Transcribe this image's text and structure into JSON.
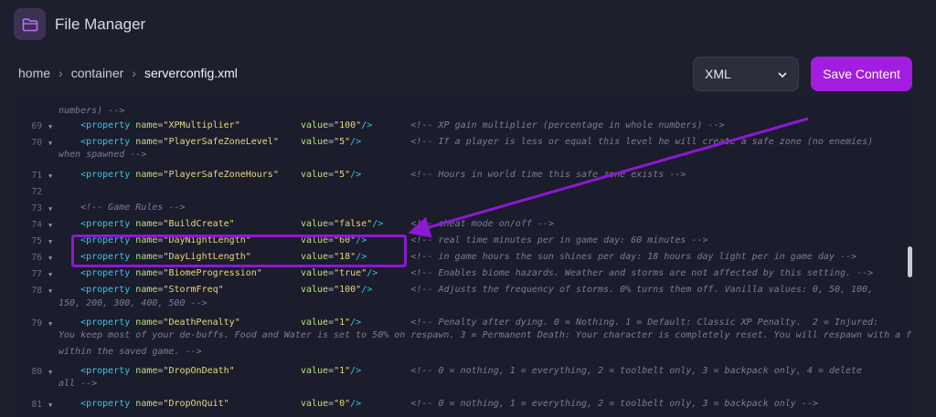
{
  "app": {
    "title": "File Manager",
    "icon": "folder-icon"
  },
  "breadcrumb": [
    "home",
    "container",
    "serverconfig.xml"
  ],
  "format_select": {
    "value": "XML"
  },
  "save_button": "Save Content",
  "editor": {
    "top_wrap": "numbers) -->",
    "lines": [
      {
        "num": "69",
        "fold": true,
        "name": "XPMultiplier",
        "value": "100",
        "comment": "<!-- XP gain multiplier (percentage in whole numbers) -->",
        "wrap": []
      },
      {
        "num": "70",
        "fold": true,
        "name": "PlayerSafeZoneLevel",
        "value": "5",
        "comment": "<!-- If a player is less or equal this level he will create a safe zone (no enemies)",
        "wrap": [
          "when spawned -->"
        ]
      },
      {
        "num": "71",
        "fold": true,
        "name": "PlayerSafeZoneHours",
        "value": "5",
        "comment": "<!-- Hours in world time this safe zone exists -->",
        "wrap": []
      },
      {
        "num": "72",
        "fold": false,
        "raw": "",
        "wrap": []
      },
      {
        "num": "73",
        "fold": true,
        "raw_comment": "<!-- Game Rules -->",
        "wrap": []
      },
      {
        "num": "74",
        "fold": true,
        "name": "BuildCreate",
        "value": "false",
        "comment": "<!-- cheat mode on/off -->",
        "wrap": []
      },
      {
        "num": "75",
        "fold": true,
        "name": "DayNightLength",
        "value": "60",
        "comment": "<!-- real time minutes per in game day: 60 minutes -->",
        "wrap": []
      },
      {
        "num": "76",
        "fold": true,
        "name": "DayLightLength",
        "value": "18",
        "comment": "<!-- in game hours the sun shines per day: 18 hours day light per in game day -->",
        "wrap": []
      },
      {
        "num": "77",
        "fold": true,
        "name": "BiomeProgression",
        "value": "true",
        "comment": "<!-- Enables biome hazards. Weather and storms are not affected by this setting. -->",
        "wrap": []
      },
      {
        "num": "78",
        "fold": true,
        "name": "StormFreq",
        "value": "100",
        "comment": "<!-- Adjusts the frequency of storms. 0% turns them off. Vanilla values: 0, 50, 100,",
        "wrap": [
          "150, 200, 300, 400, 500 -->"
        ]
      },
      {
        "num": "79",
        "fold": true,
        "name": "DeathPenalty",
        "value": "1",
        "comment": "<!-- Penalty after dying. 0 = Nothing. 1 = Default: Classic XP Penalty.  2 = Injured:",
        "wrap": [
          "You keep most of your de-buffs. Food and Water is set to 50% on respawn. 3 = Permanent Death: Your character is completely reset. You will respawn with a fresh start",
          "within the saved game. -->"
        ]
      },
      {
        "num": "80",
        "fold": true,
        "name": "DropOnDeath",
        "value": "1",
        "comment": "<!-- 0 = nothing, 1 = everything, 2 = toolbelt only, 3 = backpack only, 4 = delete",
        "wrap": [
          "all -->"
        ]
      },
      {
        "num": "81",
        "fold": true,
        "name": "DropOnQuit",
        "value": "0",
        "comment": "<!-- 0 = nothing, 1 = everything, 2 = toolbelt only, 3 = backpack only -->",
        "wrap": []
      }
    ],
    "highlighted_settings": [
      "DayNightLength",
      "DayLightLength"
    ]
  },
  "colors": {
    "accent": "#a21de0",
    "annotation": "#8b1ad1",
    "tag": "#38c6e3",
    "attribute": "#b9e27a",
    "value": "#e9d97c",
    "comment": "#7d7e95"
  }
}
